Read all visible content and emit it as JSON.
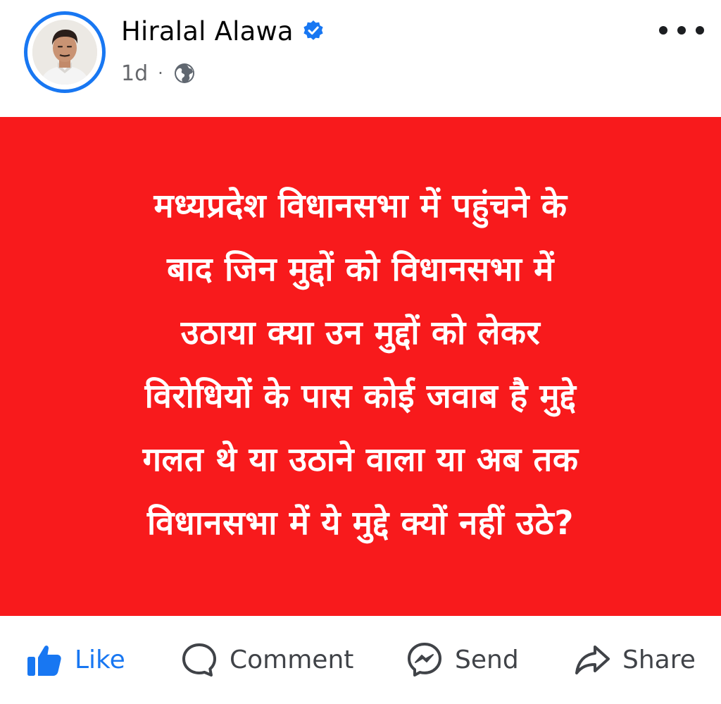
{
  "post": {
    "author": "Hiralal Alawa",
    "time": "1d",
    "separator": "·",
    "verified_icon": "verified-badge-icon",
    "privacy_icon": "globe-icon",
    "more_icon": "more-options-icon",
    "body_lines": [
      "मध्यप्रदेश विधानसभा में पहुंचने के",
      "बाद जिन मुद्दों को विधानसभा में",
      "उठाया क्या उन मुद्दों को लेकर",
      "विरोधियों के पास कोई जवाब है मुद्दे",
      "गलत थे या उठाने वाला या अब तक",
      "विधानसभा में ये मुद्दे क्यों नहीं उठे?"
    ],
    "card_color": "#f81a1c"
  },
  "actions": {
    "like": "Like",
    "comment": "Comment",
    "send": "Send",
    "share": "Share"
  },
  "colors": {
    "accent": "#1877f2",
    "text": "#050505",
    "muted": "#65676b"
  }
}
